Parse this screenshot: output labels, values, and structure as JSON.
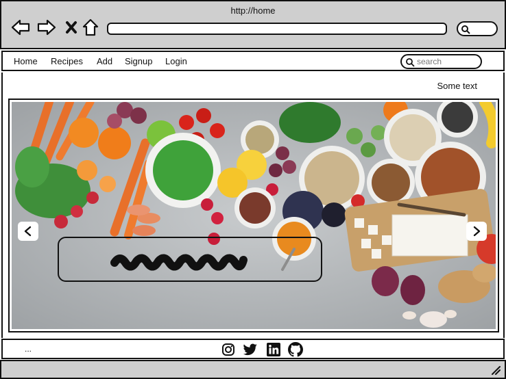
{
  "browser": {
    "url": "http://home",
    "icons": [
      "back-arrow-icon",
      "forward-arrow-icon",
      "close-icon",
      "home-icon",
      "search-icon"
    ]
  },
  "nav": {
    "links": [
      "Home",
      "Recipes",
      "Add",
      "Signup",
      "Login"
    ],
    "search_placeholder": "search"
  },
  "page": {
    "top_right_text": "Some text"
  },
  "carousel": {
    "image": "food-ingredients-photo",
    "prev_label": "<",
    "next_label": ">"
  },
  "footer": {
    "text": "...",
    "social": [
      "instagram-icon",
      "twitter-icon",
      "linkedin-icon",
      "github-icon"
    ]
  },
  "colors": {
    "chrome": "#cfcfcf",
    "border": "#111111",
    "background": "#ffffff"
  }
}
